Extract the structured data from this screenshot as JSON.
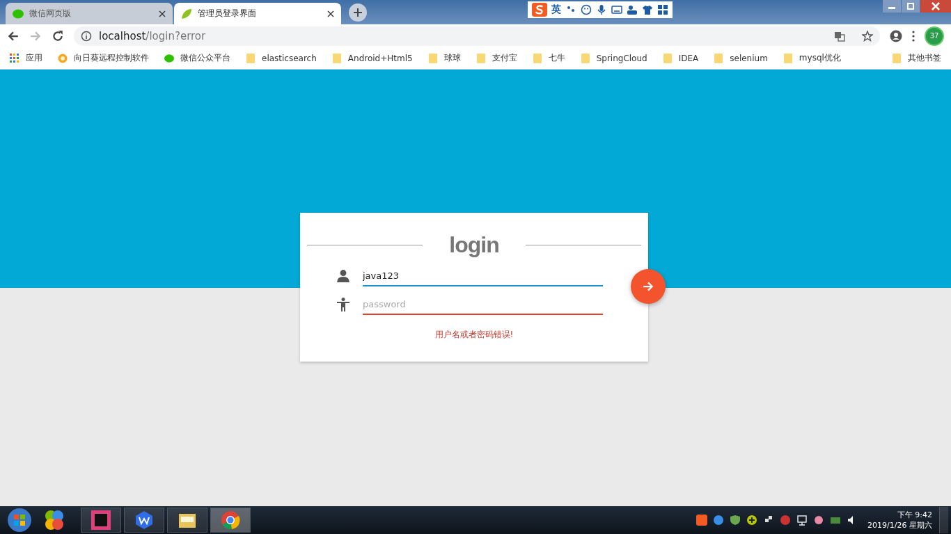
{
  "tabs": [
    {
      "title": "微信网页版",
      "kind": "wechat",
      "selected": false
    },
    {
      "title": "管理员登录界面",
      "kind": "leaf",
      "selected": true
    }
  ],
  "ime_toolbar": {
    "mode": "英"
  },
  "address_bar": {
    "host": "localhost",
    "path": "/login?error"
  },
  "extension_badge": "37",
  "bookmarks": [
    {
      "label": "应用",
      "kind": "apps"
    },
    {
      "label": "向日葵远程控制软件",
      "kind": "site"
    },
    {
      "label": "微信公众平台",
      "kind": "wechat"
    },
    {
      "label": "elasticsearch",
      "kind": "folder"
    },
    {
      "label": "Android+Html5",
      "kind": "folder"
    },
    {
      "label": "球球",
      "kind": "folder"
    },
    {
      "label": "支付宝",
      "kind": "folder"
    },
    {
      "label": "七牛",
      "kind": "folder"
    },
    {
      "label": "SpringCloud",
      "kind": "folder"
    },
    {
      "label": "IDEA",
      "kind": "folder"
    },
    {
      "label": "selenium",
      "kind": "folder"
    },
    {
      "label": "mysql优化",
      "kind": "folder"
    }
  ],
  "other_bookmarks": "其他书签",
  "login": {
    "title": "login",
    "username": {
      "value": "java123"
    },
    "password": {
      "placeholder": "password",
      "invalid": true
    },
    "error": "用户名或者密码错误!"
  },
  "clock": {
    "time": "下午 9:42",
    "date": "2019/1/26 星期六"
  }
}
